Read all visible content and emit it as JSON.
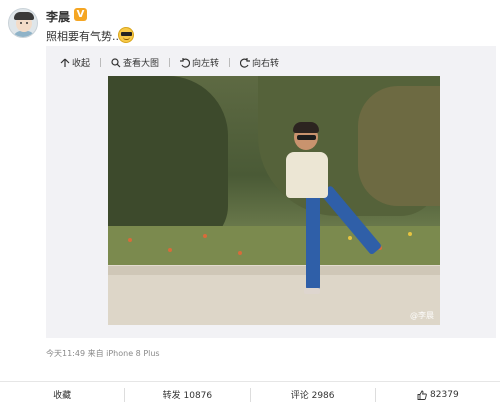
{
  "post": {
    "username": "李晨",
    "verified_badge": "V",
    "text": "照相要有气势...",
    "emoji_icon": "cool-sunglasses-emoji"
  },
  "media_toolbar": {
    "collapse_label": "收起",
    "view_large_label": "查看大图",
    "rotate_left_label": "向左转",
    "rotate_right_label": "向右转"
  },
  "photo": {
    "watermark": "@李晨"
  },
  "meta": {
    "time_source": "今天11:49 来自 iPhone 8 Plus"
  },
  "footer": {
    "favorite_label": "收藏",
    "repost_label": "转发 10876",
    "comment_label": "评论 2986",
    "like_count": "82379"
  },
  "colors": {
    "verified_badge": "#f5a623",
    "media_bg": "#f2f2f5"
  }
}
